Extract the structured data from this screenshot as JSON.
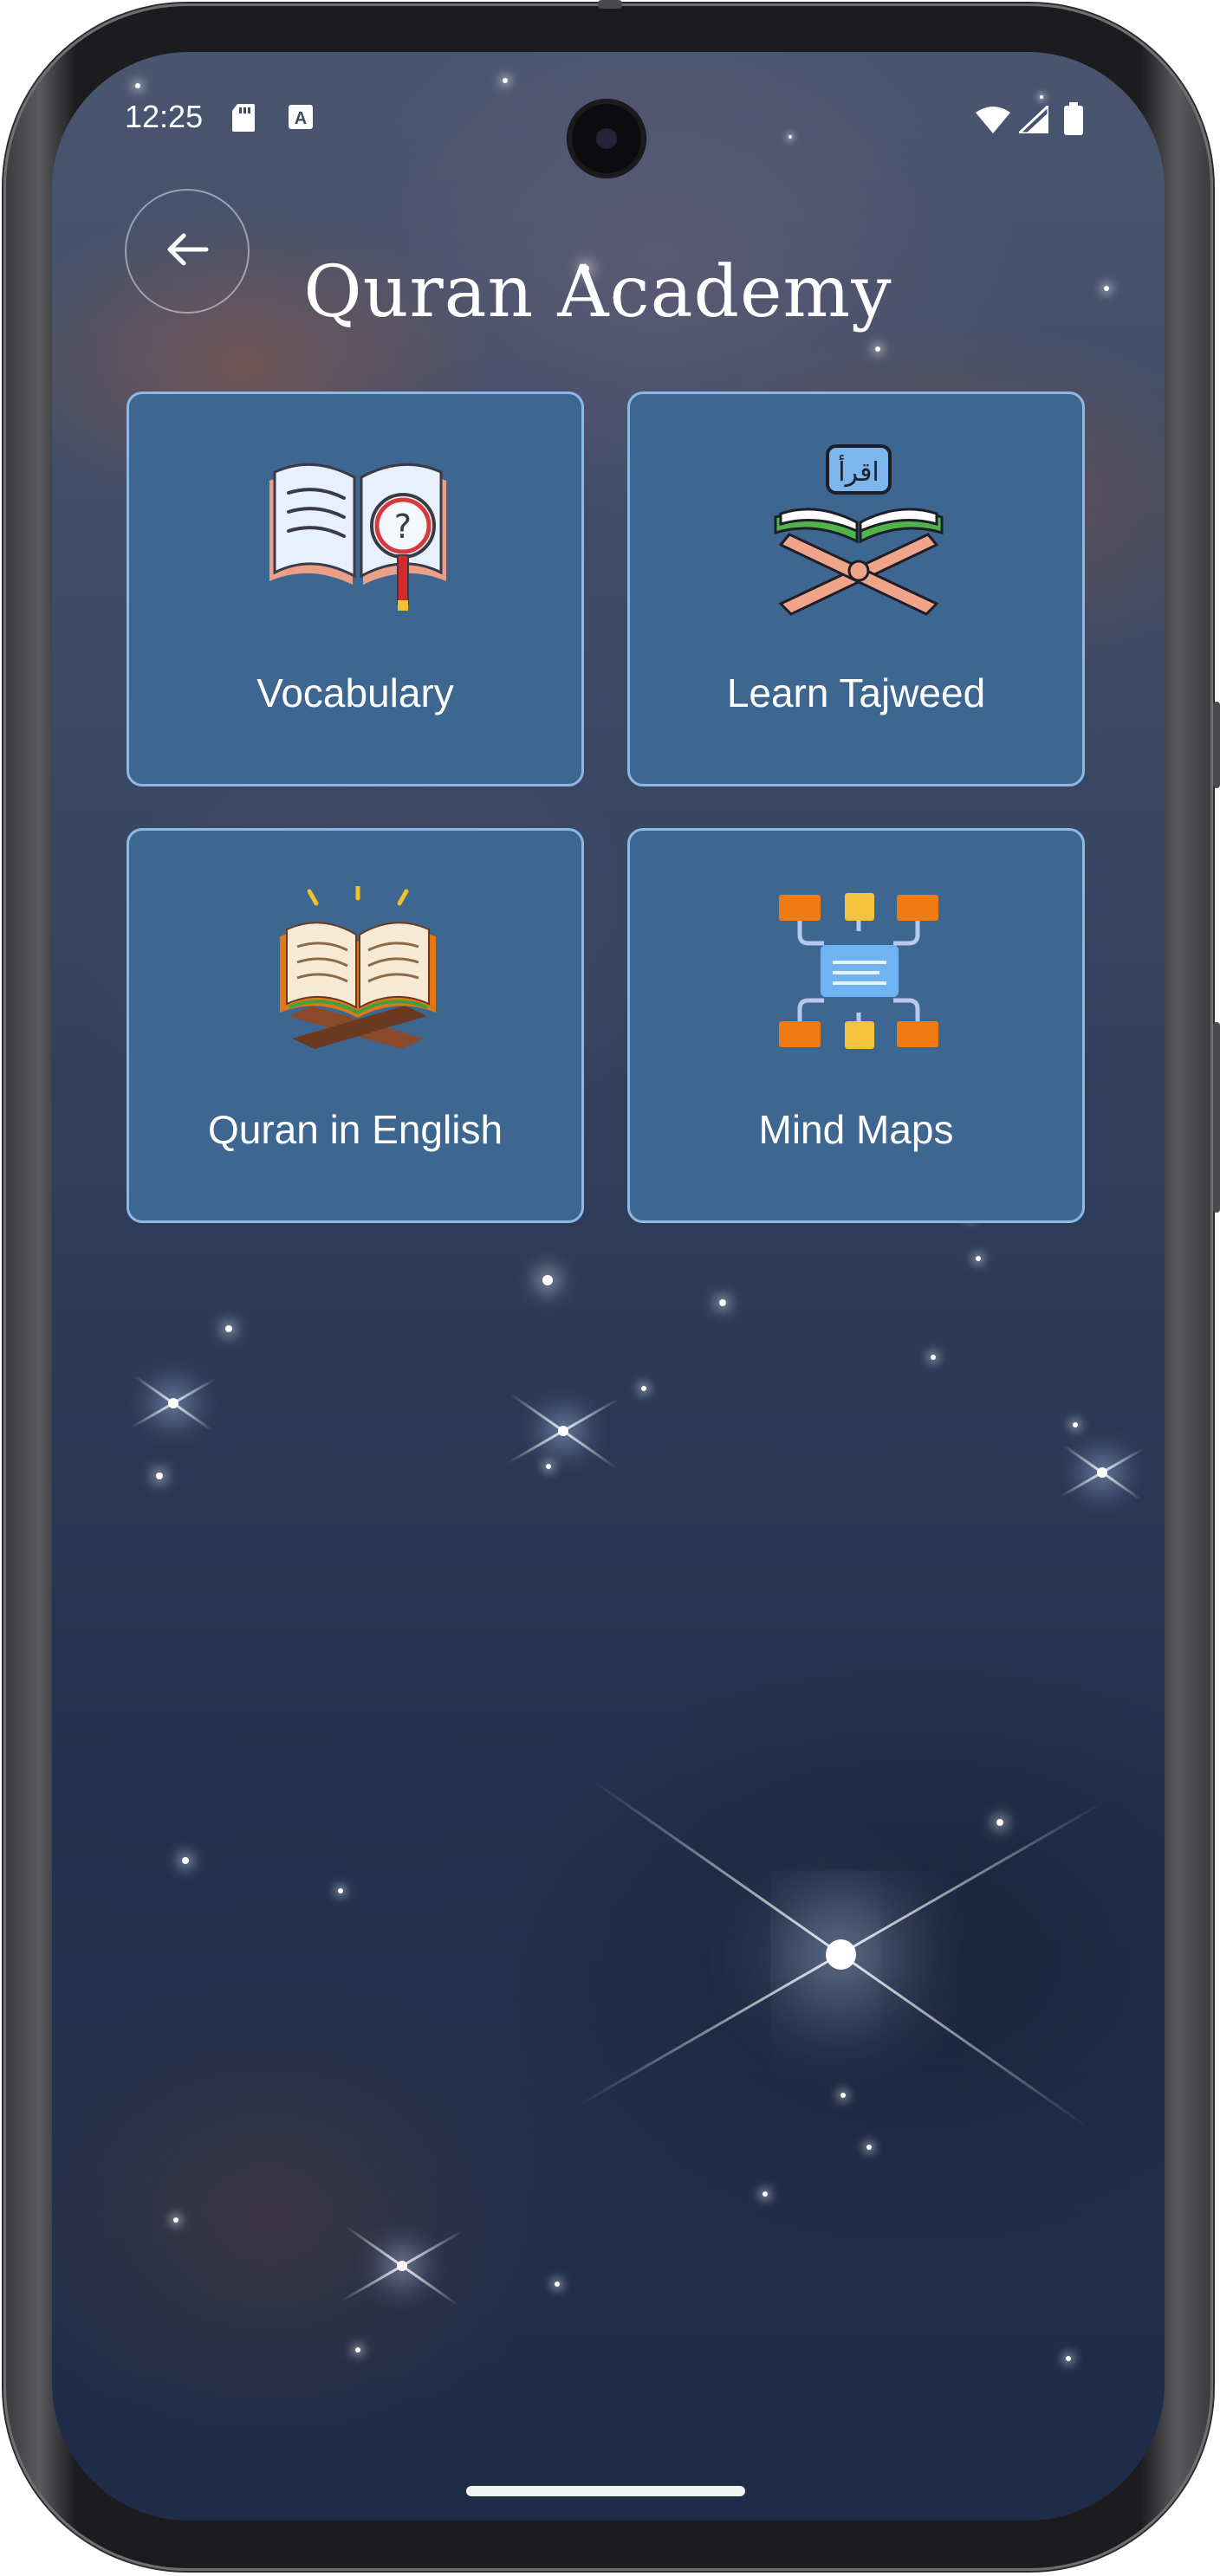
{
  "status_bar": {
    "time": "12:25",
    "icons": [
      "sd-card-icon",
      "accessibility-a-icon",
      "wifi-icon",
      "signal-icon",
      "battery-icon"
    ]
  },
  "header": {
    "back_icon": "arrow-left-icon",
    "title": "Quran Academy"
  },
  "cards": [
    {
      "label": "Vocabulary",
      "icon": "book-magnifier-icon"
    },
    {
      "label": "Learn Tajweed",
      "icon": "quran-stand-iqra-icon"
    },
    {
      "label": "Quran in English",
      "icon": "open-book-stand-icon"
    },
    {
      "label": "Mind Maps",
      "icon": "mind-map-icon"
    }
  ],
  "colors": {
    "card_bg": "#3d6690",
    "card_border": "#8db8e6",
    "text": "#ffffff"
  }
}
